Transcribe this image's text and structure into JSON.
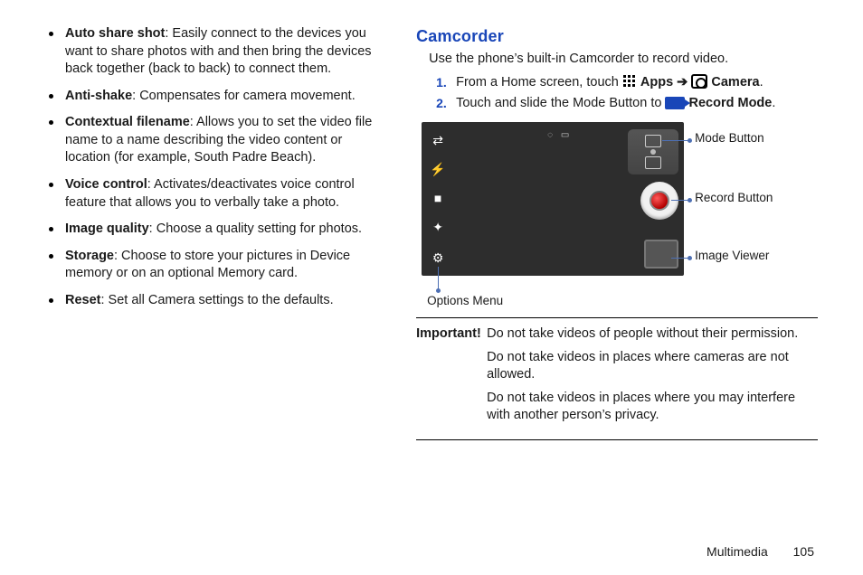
{
  "left_features": [
    {
      "label": "Auto share shot",
      "desc": ": Easily connect to the devices you want to share photos with and then bring the devices back together (back to back) to connect them."
    },
    {
      "label": "Anti-shake",
      "desc": ": Compensates for camera movement."
    },
    {
      "label": "Contextual filename",
      "desc": ": Allows you to set the video file name to a name describing the video content or location (for example, South Padre Beach)."
    },
    {
      "label": "Voice control",
      "desc": ": Activates/deactivates voice control feature that allows you to verbally take a photo."
    },
    {
      "label": "Image quality",
      "desc": ": Choose a quality setting for photos."
    },
    {
      "label": "Storage",
      "desc": ": Choose to store your pictures in Device memory or on an optional Memory card."
    },
    {
      "label": "Reset",
      "desc": ": Set all Camera settings to the defaults."
    }
  ],
  "section_title": "Camcorder",
  "intro": "Use the phone’s built-in Camcorder to record video.",
  "steps": {
    "s1_a": "From a Home screen, touch ",
    "s1_apps": "Apps",
    "s1_arrow": " ➔ ",
    "s1_camera": "Camera",
    "s1_end": ".",
    "s2_a": "Touch and slide the Mode Button to ",
    "s2_mode": "Record Mode",
    "s2_end": "."
  },
  "callouts": {
    "mode": "Mode Button",
    "record": "Record Button",
    "viewer": "Image Viewer",
    "options": "Options Menu"
  },
  "important": {
    "tag": "Important!",
    "lines": [
      "Do not take videos of people without their permission.",
      "Do not take videos in places where cameras are not allowed.",
      "Do not take videos in places where you may interfere with another person’s privacy."
    ]
  },
  "footer": {
    "chapter": "Multimedia",
    "page": "105"
  }
}
